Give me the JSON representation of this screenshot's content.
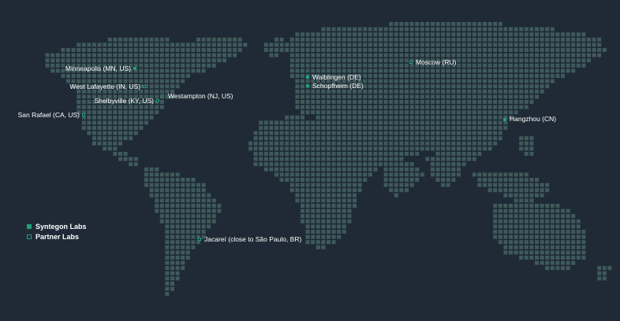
{
  "colors": {
    "background": "#1f2a36",
    "land_dot": "#3f5a5b",
    "accent": "#1fa07a",
    "label_text": "#ffffff"
  },
  "legend": {
    "syntegon": {
      "label": "Syntegon Labs",
      "style": "solid"
    },
    "partner": {
      "label": "Partner Labs",
      "style": "hollow"
    }
  },
  "locations": [
    {
      "id": "minneapolis",
      "label": "Minneapolis (MN, US)",
      "type": "syntegon"
    },
    {
      "id": "west-lafayette",
      "label": "West Lafayette (IN, US)",
      "type": "partner"
    },
    {
      "id": "westampton",
      "label": "Westampton (NJ, US)",
      "type": "partner"
    },
    {
      "id": "shelbyville",
      "label": "Shelbyville (KY, US)",
      "type": "partner"
    },
    {
      "id": "san-rafael",
      "label": "San Rafael (CA, US)",
      "type": "partner"
    },
    {
      "id": "waiblingen",
      "label": "Waiblingen (DE)",
      "type": "syntegon"
    },
    {
      "id": "schopfheim",
      "label": "Schopfheim (DE)",
      "type": "syntegon"
    },
    {
      "id": "moscow",
      "label": "Moscow (RU)",
      "type": "partner"
    },
    {
      "id": "hangzhou",
      "label": "Hangzhou (CN)",
      "type": "syntegon"
    },
    {
      "id": "jacarei",
      "label": "Jacareí (close to São Paulo, BR)",
      "type": "partner"
    }
  ]
}
